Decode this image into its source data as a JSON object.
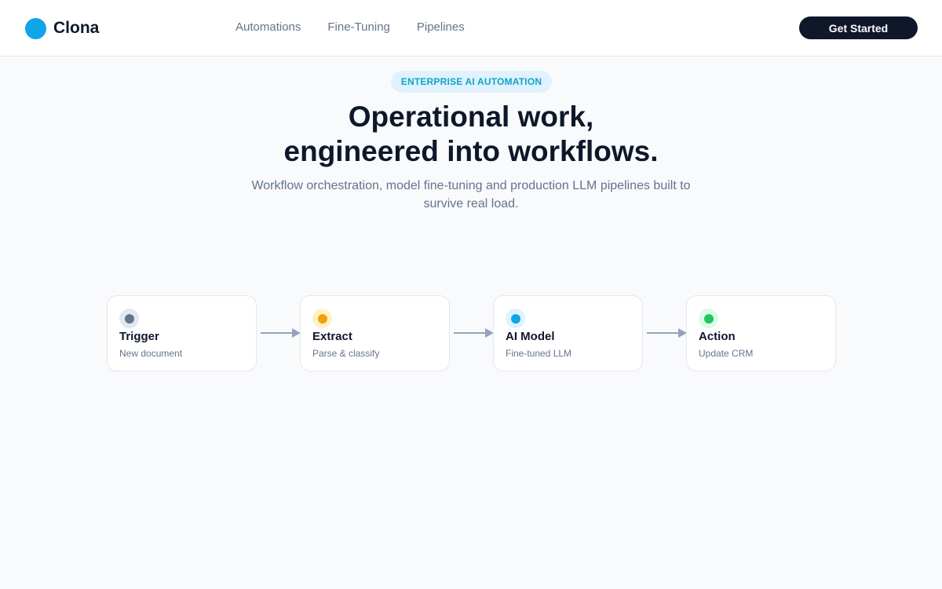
{
  "brand": {
    "name": "Clona",
    "color": "#0ea5e9"
  },
  "nav": {
    "items": [
      {
        "label": "Automations"
      },
      {
        "label": "Fine-Tuning"
      },
      {
        "label": "Pipelines"
      }
    ],
    "cta_label": "Get Started"
  },
  "hero": {
    "badge": "ENTERPRISE AI AUTOMATION",
    "headline_line1": "Operational work,",
    "headline_line2": "engineered into workflows.",
    "subhead": "Workflow orchestration, model fine-tuning and production LLM pipelines built to survive real load."
  },
  "flow": {
    "steps": [
      {
        "title": "Trigger",
        "subtitle": "New document",
        "dot_color": "#64748b",
        "ring_color": "#e2e8f0"
      },
      {
        "title": "Extract",
        "subtitle": "Parse & classify",
        "dot_color": "#f59e0b",
        "ring_color": "#fef3c7"
      },
      {
        "title": "AI Model",
        "subtitle": "Fine-tuned LLM",
        "dot_color": "#0ea5e9",
        "ring_color": "#e0f2fe"
      },
      {
        "title": "Action",
        "subtitle": "Update CRM",
        "dot_color": "#22c55e",
        "ring_color": "#dcfce7"
      }
    ],
    "connector_color": "#94a3b8"
  }
}
